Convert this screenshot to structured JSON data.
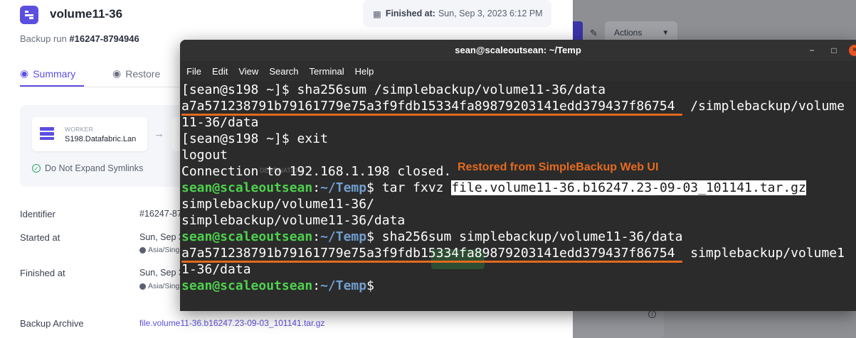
{
  "app": {
    "volume_title": "volume11-36",
    "finished_label": "Finished at:",
    "finished_value": "Sun, Sep 3, 2023 6:12 PM",
    "run_prefix": "Backup run",
    "run_id": "#16247-8794946",
    "tabs": [
      {
        "label": "Summary",
        "active": true
      },
      {
        "label": "Restore",
        "active": false
      }
    ],
    "worker_label": "WORKER",
    "worker_value": "S198.Datafabric.Lan",
    "symlinks": "Do Not Expand Symlinks",
    "details": {
      "identifier_label": "Identifier",
      "identifier_value": "#16247-87",
      "started_label": "Started at",
      "started_value": "Sun, Sep 3",
      "started_tz": "Asia/Sing",
      "finished_label": "Finished at",
      "finished_value": "Sun, Sep 3",
      "finished_tz": "Asia/Sing",
      "archive_label": "Backup Archive",
      "archive_value": "file.volume11-36.b16247.23-09-03_101141.tar.gz"
    },
    "actions_label": "Actions",
    "accent_color": "#5b4fe0"
  },
  "terminal": {
    "title": "sean@scaleoutsean: ~/Temp",
    "menu": [
      "File",
      "Edit",
      "View",
      "Search",
      "Terminal",
      "Help"
    ],
    "lines": {
      "l1": "[sean@s198 ~]$ sha256sum /simplebackup/volume11-36/data",
      "l2_hash": "a7a571238791b79161779e75a3f9fdb15334fa89879203141edd379437f86754",
      "l2_path": "  /simplebackup/volume",
      "l3": "11-36/data",
      "l4": "[sean@s198 ~]$ exit",
      "l5": "logout",
      "l6": "Connection to 192.168.1.198 closed.",
      "prompt_user": "sean@scaleoutsean",
      "prompt_sep": ":",
      "prompt_dir": "~/Temp",
      "prompt_dollar": "$ ",
      "l7_cmd": "tar fxvz ",
      "l7_file": "file.volume11-36.b16247.23-09-03_101141.tar.gz",
      "l8": "simplebackup/volume11-36/",
      "l9": "simplebackup/volume11-36/data",
      "l10_cmd": "sha256sum simplebackup/volume11-36/data",
      "l11_hash": "a7a571238791b79161779e75a3f9fdb15334fa89879203141edd379437f86754",
      "l11_path": "  simplebackup/volume1",
      "l12": "1-36/data"
    },
    "annotation": "Restored from SimpleBackup Web UI",
    "underline_color": "#e36a1e",
    "prompt_color": "#4ed14e",
    "dir_color": "#729fcf"
  }
}
